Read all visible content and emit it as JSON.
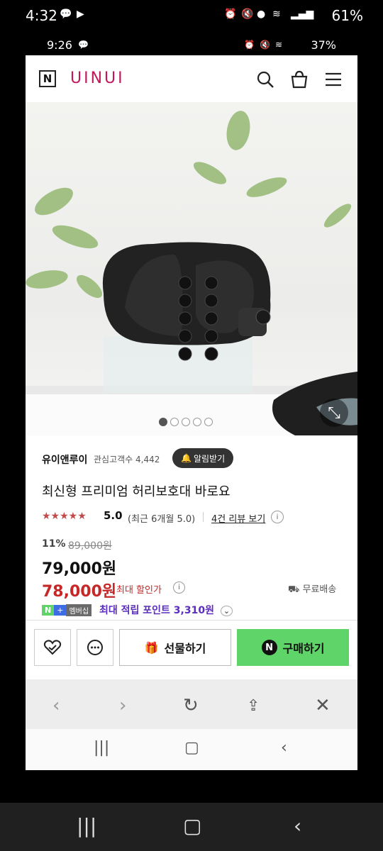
{
  "outer_status": {
    "time": "4:32",
    "battery": "61%"
  },
  "inner_status": {
    "time": "9:26",
    "battery": "37%"
  },
  "header": {
    "brand": "UINUI"
  },
  "product": {
    "seller": "유이앤루이",
    "watchers": "관심고객수 4,442",
    "alarm_label": "알림받기",
    "title": "최신형 프리미엄 허리보호대 바로요",
    "stars": "★★★★★",
    "rating": "5.0",
    "rating_detail": "(최근 6개월 5.0)",
    "review_link": "4건 리뷰 보기",
    "discount": "11%",
    "original_price": "89,000원",
    "price": "79,000원",
    "best_price": "78,000원",
    "best_label": "최대 할인가",
    "shipping": "무료배송",
    "npay_badge": "N",
    "plus_badge": "+",
    "member_badge": "멤버십",
    "points": "최대 적립 포인트 3,310원"
  },
  "carousel": {
    "count": 5,
    "active": 0
  },
  "actions": {
    "gift": "선물하기",
    "buy": "구매하기"
  }
}
